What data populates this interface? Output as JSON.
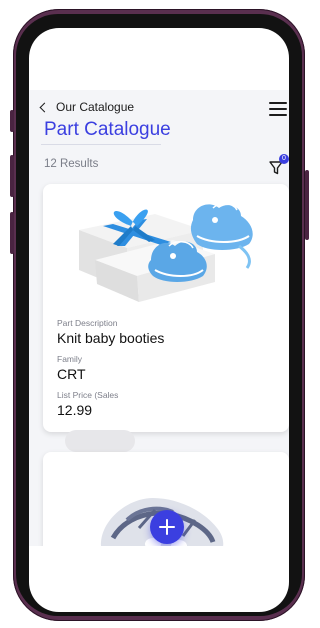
{
  "header": {
    "back_label": "Our Catalogue",
    "title": "Part Catalogue"
  },
  "results": {
    "count_text": "12 Results",
    "filter_badge": "0"
  },
  "products": [
    {
      "image_icon": "baby-booties-gift-image",
      "fields": [
        {
          "label": "Part Description",
          "value": "Knit baby booties"
        },
        {
          "label": "Family",
          "value": "CRT"
        },
        {
          "label": "List Price (Sales",
          "value": "12.99"
        }
      ]
    },
    {
      "image_icon": "sandal-image"
    }
  ],
  "colors": {
    "accent": "#3b3fe0",
    "frame": "#5a2f4f",
    "background": "#f4f5f8"
  },
  "icons": {
    "back": "chevron-left-icon",
    "menu": "hamburger-icon",
    "filter": "filter-funnel-icon",
    "add": "plus-icon"
  }
}
